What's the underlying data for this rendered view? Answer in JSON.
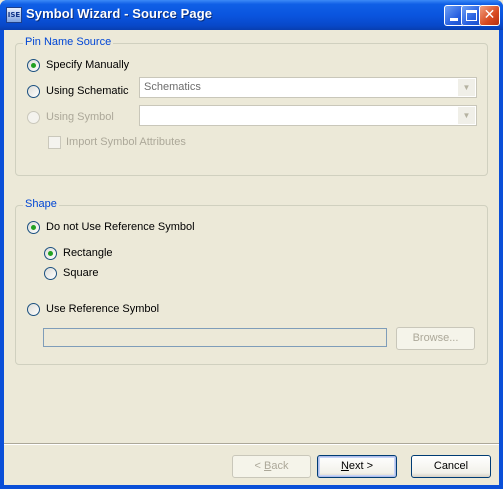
{
  "window": {
    "title": "Symbol Wizard - Source Page",
    "app_icon_text": "ISE"
  },
  "pin_name_source": {
    "legend": "Pin Name Source",
    "specify_manually": {
      "label": "Specify Manually",
      "checked": true
    },
    "using_schematic": {
      "label": "Using Schematic",
      "checked": false,
      "combo_value": "Schematics"
    },
    "using_symbol": {
      "label": "Using Symbol",
      "checked": false,
      "disabled": true,
      "combo_value": ""
    },
    "import_attributes": {
      "label": "Import Symbol Attributes",
      "checked": false,
      "disabled": true
    }
  },
  "shape": {
    "legend": "Shape",
    "do_not_use_reference": {
      "label": "Do not Use Reference Symbol",
      "checked": true
    },
    "rectangle": {
      "label": "Rectangle",
      "checked": true
    },
    "square": {
      "label": "Square",
      "checked": false
    },
    "use_reference": {
      "label": "Use Reference Symbol",
      "checked": false
    },
    "reference_path": "",
    "browse_label": "Browse..."
  },
  "buttons": {
    "back_accel": "B",
    "back_rest": "ack",
    "back_prefix": "< ",
    "next_accel": "N",
    "next_rest": "ext >",
    "cancel_label": "Cancel"
  },
  "icons": {
    "minimize": "minimize-icon",
    "maximize": "maximize-icon",
    "close": "close-icon",
    "dropdown": "chevron-down-icon"
  },
  "colors": {
    "titlebar": "#0a55df",
    "group_legend": "#0046d5",
    "radio_dot": "#21a121",
    "dialog_bg": "#ece9d8"
  }
}
